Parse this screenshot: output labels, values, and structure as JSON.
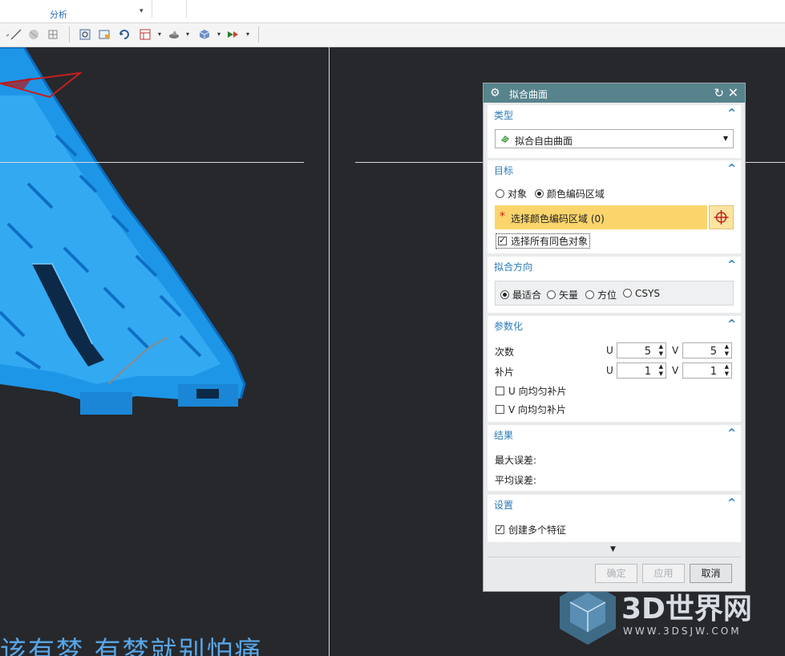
{
  "ribbon": {
    "tab_label": "分析"
  },
  "viewport": {
    "slogan": "该有梦 有梦就别怕痛"
  },
  "watermark": {
    "brand": "3D世界网",
    "url": "WWW.3DSJW.COM"
  },
  "dialog": {
    "title": "拟合曲面",
    "type_section": {
      "heading": "类型",
      "selected": "拟合自由曲面"
    },
    "target_section": {
      "heading": "目标",
      "option_object": "对象",
      "option_color_region": "颜色编码区域",
      "select_prompt": "选择颜色编码区域 (0)",
      "select_all_same_color": "选择所有同色对象"
    },
    "fit_direction_section": {
      "heading": "拟合方向",
      "options": [
        "最适合",
        "矢量",
        "方位",
        "CSYS"
      ]
    },
    "param_section": {
      "heading": "参数化",
      "degree_label": "次数",
      "patch_label": "补片",
      "u_label": "U",
      "v_label": "V",
      "degree_u": "5",
      "degree_v": "5",
      "patch_u": "1",
      "patch_v": "1",
      "u_uniform": "U 向均匀补片",
      "v_uniform": "V 向均匀补片"
    },
    "result_section": {
      "heading": "结果",
      "max_error": "最大误差:",
      "avg_error": "平均误差:"
    },
    "settings_section": {
      "heading": "设置",
      "create_multiple": "创建多个特征"
    },
    "buttons": {
      "ok": "确定",
      "apply": "应用",
      "cancel": "取消"
    }
  }
}
